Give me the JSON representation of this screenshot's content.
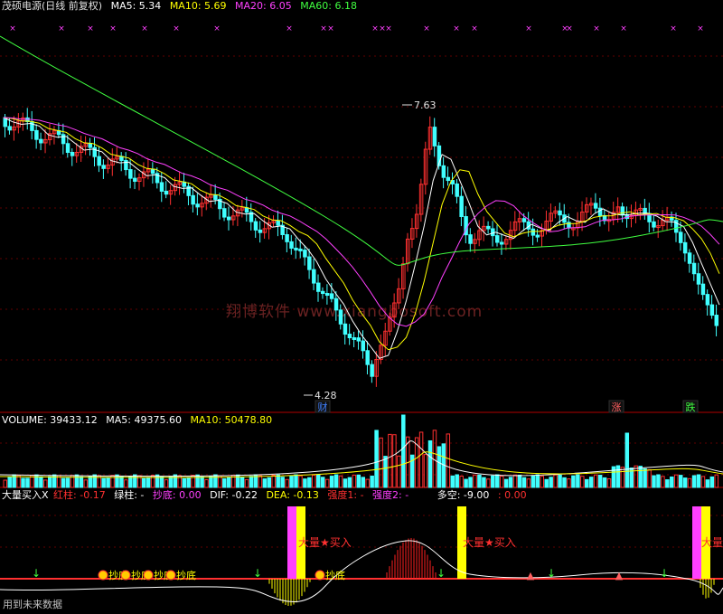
{
  "header": {
    "title": "茂硕电源(日线 前复权)",
    "ma5": "MA5: 5.34",
    "ma10": "MA10: 5.69",
    "ma20": "MA20: 6.05",
    "ma60": "MA60: 6.18"
  },
  "price_panel": {
    "high_label": "7.63",
    "low_label": "4.28",
    "markers": [
      "财",
      "涨",
      "跌"
    ]
  },
  "volume_panel": {
    "label": "VOLUME: 39433.12",
    "ma5": "MA5: 49375.60",
    "ma10": "MA10: 50478.80"
  },
  "indicator_panel": {
    "name": "大量买入X",
    "red_col": "红柱: -0.17",
    "green_col": "绿柱: -",
    "chaodi": "抄底: 0.00",
    "dif": "DIF: -0.22",
    "dea": "DEA: -0.13",
    "qiangdu1": "强度1: -",
    "qiangdu2": "强度2: -",
    "duokong": "多空: -9.00",
    "extra": ": 0.00",
    "buy_signal": "大量★买入",
    "chaodi_tag": "抄底"
  },
  "watermark": "翔博软件 www.xiangbosoft.com",
  "footer_note": "用到未来数据",
  "colors": {
    "up": "#ff3030",
    "down": "#40ffff",
    "ma5": "#ffffff",
    "ma10": "#ffff00",
    "ma20": "#ff40ff",
    "ma60": "#40ff40"
  }
}
